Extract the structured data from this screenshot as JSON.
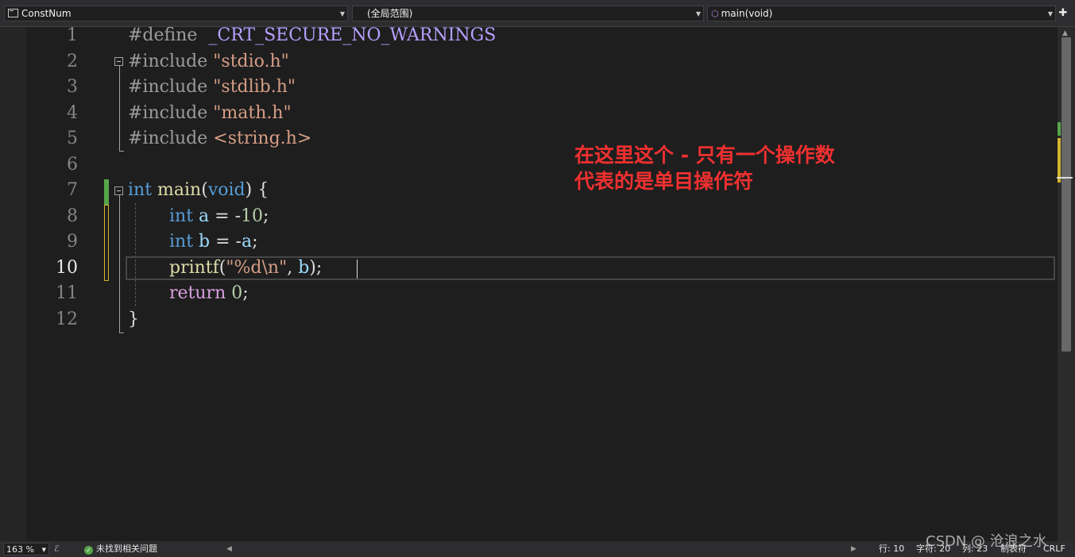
{
  "navbar": {
    "project": "ConstNum",
    "scope": "(全局范围)",
    "member": "main(void)"
  },
  "lines": [
    "1",
    "2",
    "3",
    "4",
    "5",
    "6",
    "7",
    "8",
    "9",
    "10",
    "11",
    "12"
  ],
  "code": {
    "l1": {
      "directive": "#define",
      "macro": "_CRT_SECURE_NO_WARNINGS"
    },
    "l2": {
      "directive": "#include",
      "header": "\"stdio.h\""
    },
    "l3": {
      "directive": "#include",
      "header": "\"stdlib.h\""
    },
    "l4": {
      "directive": "#include",
      "header": "\"math.h\""
    },
    "l5": {
      "directive": "#include",
      "header": "<string.h>"
    },
    "l7": {
      "type": "int",
      "name": "main",
      "open": "(",
      "param": "void",
      "close": ") {"
    },
    "l8": {
      "type": "int",
      "var": "a",
      "op": " = -",
      "value": "10",
      "end": ";"
    },
    "l9": {
      "type": "int",
      "var": "b",
      "op": " = -",
      "ref": "a",
      "end": ";"
    },
    "l10": {
      "fn": "printf",
      "open": "(",
      "str": "\"%d\\n\"",
      "sep": ", ",
      "arg": "b",
      "end": ");"
    },
    "l11": {
      "kw": "return",
      "value": "0",
      "end": ";"
    },
    "l12": {
      "brace": "}"
    }
  },
  "annotation": {
    "line1": "在这里这个 - 只有一个操作数",
    "line2": "代表的是单目操作符"
  },
  "status": {
    "zoom": "163 %",
    "issues": "未找到相关问题",
    "line": "行: 10",
    "char": "字符: 20",
    "col": "列: 23",
    "tabs": "制表符",
    "eol": "CRLF"
  },
  "watermark": "CSDN @ 沧浪之水",
  "colors": {
    "background": "#1e1e1e",
    "keyword": "#569cd6",
    "string": "#d69d85",
    "function": "#dcdcaa",
    "variable": "#9cdcfe",
    "number": "#b5cea8",
    "annotation": "#f03030",
    "saved_change": "#57a64a",
    "unsaved_change": "#d2b630"
  }
}
